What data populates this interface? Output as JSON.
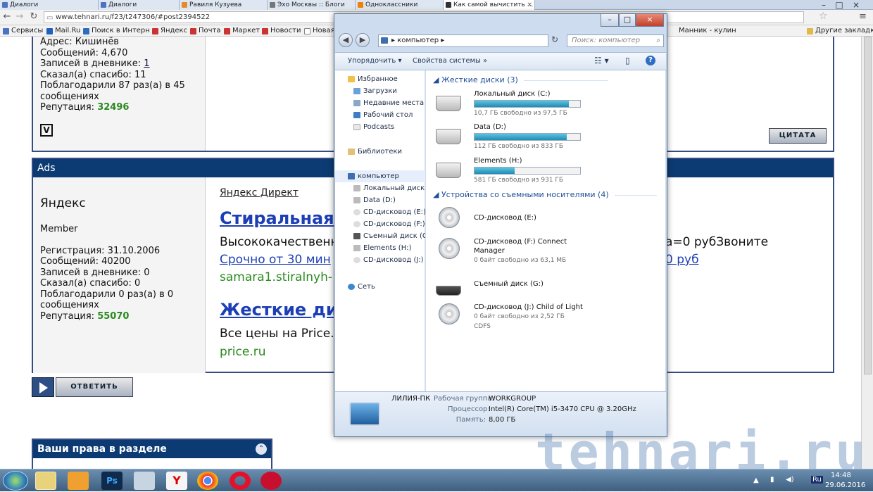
{
  "tabs": [
    {
      "label": "Диалоги",
      "active": false
    },
    {
      "label": "Диалоги",
      "active": false
    },
    {
      "label": "Равиля Кузуева",
      "active": false
    },
    {
      "label": "Эхо Москвы :: Блоги",
      "active": false
    },
    {
      "label": "Одноклассники",
      "active": false
    },
    {
      "label": "Как самой вычистить ...",
      "active": true
    }
  ],
  "browser": {
    "url": "www.tehnari.ru/f23/t247306/#post2394522",
    "other_bookmarks": "Другие закладки"
  },
  "bookmarks": [
    "Сервисы",
    "Mail.Ru",
    "Поиск в Интерн",
    "Яндекс",
    "Почта",
    "Маркет",
    "Новости",
    "Новая",
    "Манник - кулин"
  ],
  "post1": {
    "lines": [
      "Адрес: Кишинёв",
      "Сообщений: 4,670"
    ],
    "diary_label": "Записей в дневнике:",
    "diary_link": "1",
    "thanks": "Сказал(а) спасибо: 11",
    "thanked1": "Поблагодарили 87 раз(а) в 45",
    "thanked2": "сообщениях",
    "rep_label": "Репутация:",
    "rep_value": "32496",
    "quote_button": "ЦИТАТА"
  },
  "ads": {
    "header": "Ads",
    "user_name": "Яндекс",
    "user_rank": "Member",
    "reg": "Регистрация: 31.10.2006",
    "msgs": "Сообщений: 40200",
    "diary": "Записей в дневнике: 0",
    "thanks": "Сказал(а) спасибо: 0",
    "thanked1": "Поблагодарили 0 раз(а) в 0",
    "thanked2": "сообщениях",
    "rep_label": "Репутация:",
    "rep_value": "55070",
    "direct": "Яндекс Директ",
    "ad1_title": "Стиральная",
    "ad1_text": "Высококачественн",
    "ad1_text_right": "а=0 рубЗвоните",
    "ad1_link": "Срочно от 30 мин",
    "ad1_link_right": "0 руб",
    "ad1_domain": "samara1.stiralnyh-",
    "ad2_title": "Жесткие ди",
    "ad2_text": "Все цены на Price.",
    "ad2_domain": "price.ru"
  },
  "reply_button": "ОТВЕТИТЬ",
  "rights_box": {
    "title": "Ваши права в разделе"
  },
  "explorer": {
    "breadcrumb": "компьютер",
    "search_placeholder": "Поиск: компьютер",
    "toolbar": {
      "organize": "Упорядочить",
      "system_props": "Свойства системы"
    },
    "nav": {
      "favorites": "Избранное",
      "fav_items": [
        "Загрузки",
        "Недавние места",
        "Рабочий стол",
        "Podcasts"
      ],
      "libraries": "Библиотеки",
      "computer": "компьютер",
      "computer_items": [
        "Локальный диск (C:)",
        "Data (D:)",
        "CD-дисковод (E:)",
        "CD-дисковод (F:) Co",
        "Съемный диск (G:)",
        "Elements (H:)",
        "CD-дисковод (J:) Ch"
      ],
      "network": "Сеть"
    },
    "hdd_group": "Жесткие диски (3)",
    "hdd": [
      {
        "name": "Локальный диск (C:)",
        "free": "10,7 ГБ свободно из 97,5 ГБ",
        "used_fraction": 0.89
      },
      {
        "name": "Data (D:)",
        "free": "112 ГБ свободно из 833 ГБ",
        "used_fraction": 0.87
      },
      {
        "name": "Elements (H:)",
        "free": "581 ГБ свободно из 931 ГБ",
        "used_fraction": 0.38
      }
    ],
    "removable_group": "Устройства со съемными носителями (4)",
    "removable": [
      {
        "name": "CD-дисковод (E:)"
      },
      {
        "name": "CD-дисковод (F:) Connect",
        "name2": "Manager",
        "free": "0 байт свободно из 63,1 МБ"
      },
      {
        "name": "Съемный диск (G:)"
      },
      {
        "name": "CD-дисковод (J:) Child of Light",
        "free": "0 байт свободно из 2,52 ГБ",
        "fs": "CDFS"
      }
    ],
    "details": {
      "pc_name": "ЛИЛИЯ-ПК",
      "workgroup_label": "Рабочая группа:",
      "workgroup": "WORKGROUP",
      "cpu_label": "Процессор:",
      "cpu": "Intel(R) Core(TM) i5-3470 CPU @ 3.20GHz",
      "ram_label": "Память:",
      "ram": "8,00 ГБ"
    }
  },
  "taskbar": {
    "time": "14:48",
    "date": "29.06.2016",
    "lang": "Ru"
  },
  "watermark": "tehnari.ru"
}
